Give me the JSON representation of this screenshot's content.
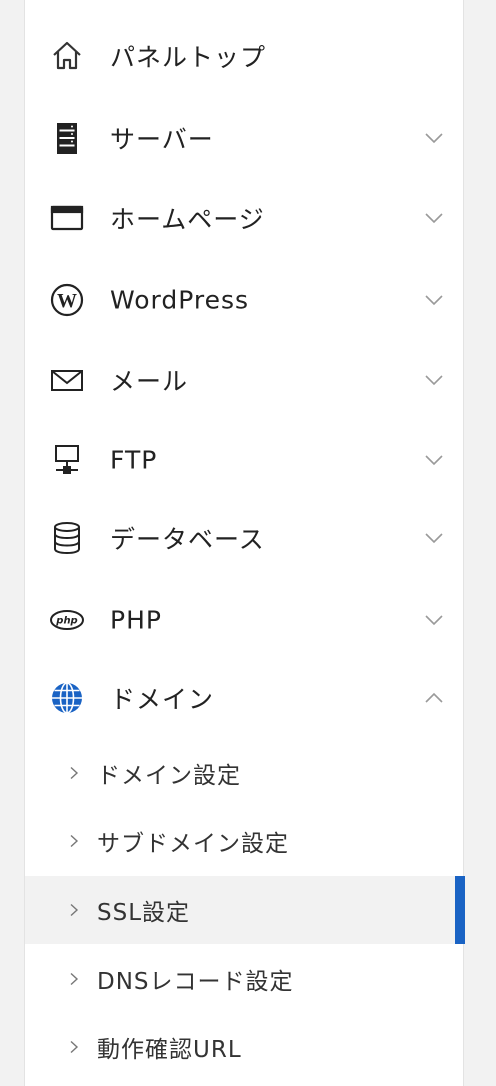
{
  "menu": {
    "items": [
      {
        "label": "パネルトップ",
        "icon": "home-icon"
      },
      {
        "label": "サーバー",
        "icon": "server-icon"
      },
      {
        "label": "ホームページ",
        "icon": "browser-window-icon"
      },
      {
        "label": "WordPress",
        "icon": "wordpress-icon"
      },
      {
        "label": "メール",
        "icon": "mail-icon"
      },
      {
        "label": "FTP",
        "icon": "ftp-network-icon"
      },
      {
        "label": "データベース",
        "icon": "database-icon"
      },
      {
        "label": "PHP",
        "icon": "php-icon"
      },
      {
        "label": "ドメイン",
        "icon": "globe-icon",
        "expanded": true
      }
    ],
    "domain_submenu": [
      {
        "label": "ドメイン設定"
      },
      {
        "label": "サブドメイン設定"
      },
      {
        "label": "SSL設定",
        "active": true
      },
      {
        "label": "DNSレコード設定"
      },
      {
        "label": "動作確認URL"
      }
    ]
  },
  "colors": {
    "accent": "#1a63c4",
    "active_bg": "#f2f2f2",
    "text": "#222222",
    "chevron": "#9a9a9a"
  }
}
